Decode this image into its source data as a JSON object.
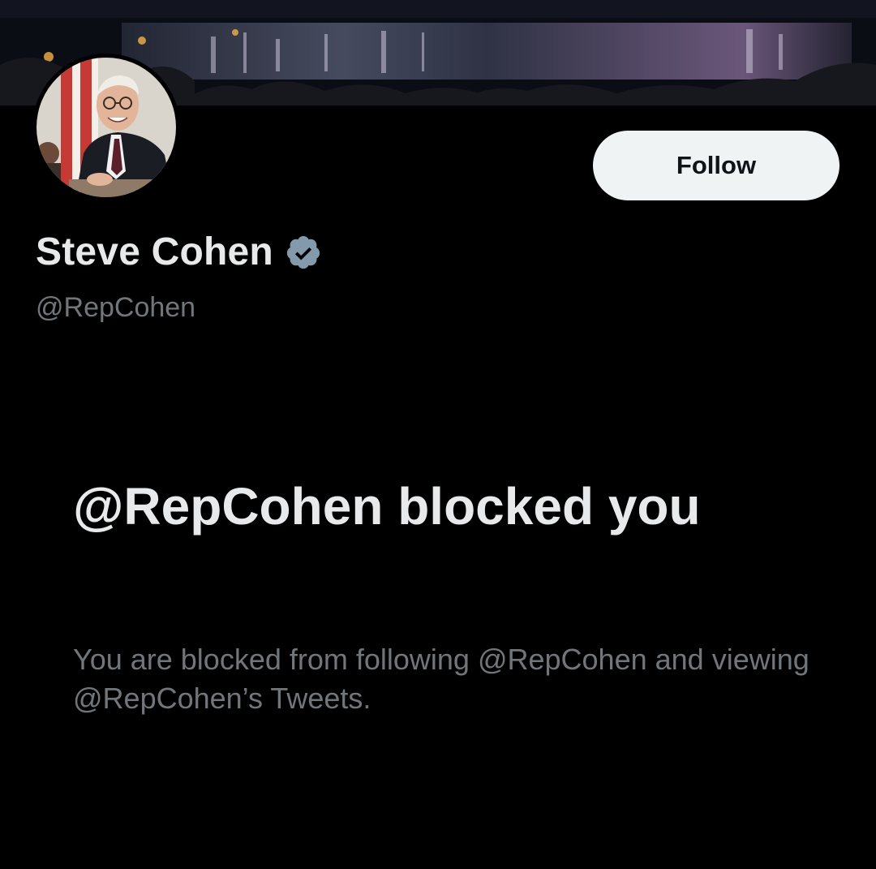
{
  "profile": {
    "display_name": "Steve Cohen",
    "handle": "@RepCohen",
    "verified_icon": "verified-badge-icon",
    "banner_image": "night-riverfront-banner",
    "avatar_image": "profile-photo"
  },
  "actions": {
    "follow_label": "Follow"
  },
  "blocked": {
    "title": "@RepCohen blocked you",
    "description": "You are blocked from following @RepCohen and viewing @RepCohen’s Tweets."
  },
  "colors": {
    "background": "#000000",
    "primary_text": "#e7e9ea",
    "secondary_text": "#71767b",
    "button_bg": "#eff3f4",
    "button_text": "#0f1419",
    "verified_badge": "#829aab"
  }
}
